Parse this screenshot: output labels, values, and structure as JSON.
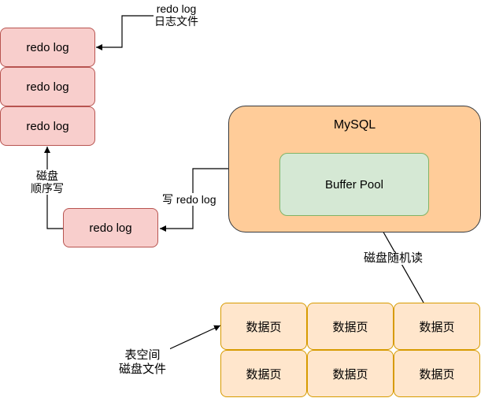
{
  "redo_log_file_label": [
    "redo log",
    "日志文件"
  ],
  "redo_log_blocks": [
    "redo log",
    "redo log",
    "redo log"
  ],
  "disk_sequential_write_label": [
    "磁盘",
    "顺序写"
  ],
  "redo_log_buffer": "redo log",
  "write_redo_log_label": "写 redo log",
  "mysql": {
    "title": "MySQL",
    "buffer_pool": "Buffer Pool"
  },
  "disk_random_read_label": "磁盘随机读",
  "data_pages": [
    "数据页",
    "数据页",
    "数据页",
    "数据页",
    "数据页",
    "数据页"
  ],
  "tablespace_file_label": [
    "表空间",
    "磁盘文件"
  ],
  "colors": {
    "redo_fill": "#f8cecc",
    "redo_border": "#b85450",
    "mysql_fill": "#ffcc99",
    "mysql_border": "#36393d",
    "pool_fill": "#d5e8d4",
    "pool_border": "#82b366",
    "page_fill": "#ffe6cc",
    "page_border": "#d79b00"
  }
}
